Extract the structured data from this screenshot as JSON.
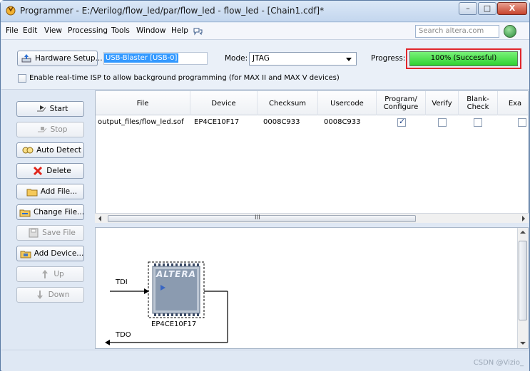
{
  "window": {
    "title": "Programmer - E:/Verilog/flow_led/par/flow_led - flow_led - [Chain1.cdf]*",
    "minimize": "–",
    "maximize": "□",
    "close": "X"
  },
  "menu": {
    "file": "File",
    "edit": "Edit",
    "view": "View",
    "processing": "Processing",
    "tools": "Tools",
    "window": "Window",
    "help": "Help",
    "search_placeholder": "Search altera.com"
  },
  "toolbar": {
    "hardware_setup": "Hardware Setup...",
    "hardware_value": "USB-Blaster [USB-0]",
    "mode_label": "Mode:",
    "mode_value": "JTAG",
    "progress_label": "Progress:",
    "progress_text": "100% (Successful)",
    "progress_fraction": 1.0,
    "enable_realtime": "Enable real-time ISP to allow background programming (for MAX II and MAX V devices)"
  },
  "side_buttons": {
    "start": "Start",
    "stop": "Stop",
    "auto_detect": "Auto Detect",
    "delete": "Delete",
    "add_file": "Add File...",
    "change_file": "Change File...",
    "save_file": "Save File",
    "add_device": "Add Device...",
    "up": "Up",
    "down": "Down"
  },
  "table": {
    "headers": [
      "File",
      "Device",
      "Checksum",
      "Usercode",
      "Program/ Configure",
      "Verify",
      "Blank- Check",
      "Exa"
    ],
    "rows": [
      {
        "file": "output_files/flow_led.sof",
        "device": "EP4CE10F17",
        "checksum": "0008C933",
        "usercode": "0008C933",
        "program": true,
        "verify": false,
        "blank": false
      }
    ],
    "scroll_marker": "III"
  },
  "chain": {
    "tdi": "TDI",
    "tdo": "TDO",
    "chip_logo": "ALTERA",
    "device": "EP4CE10F17"
  },
  "status": {
    "watermark": "CSDN @Vizio_"
  }
}
